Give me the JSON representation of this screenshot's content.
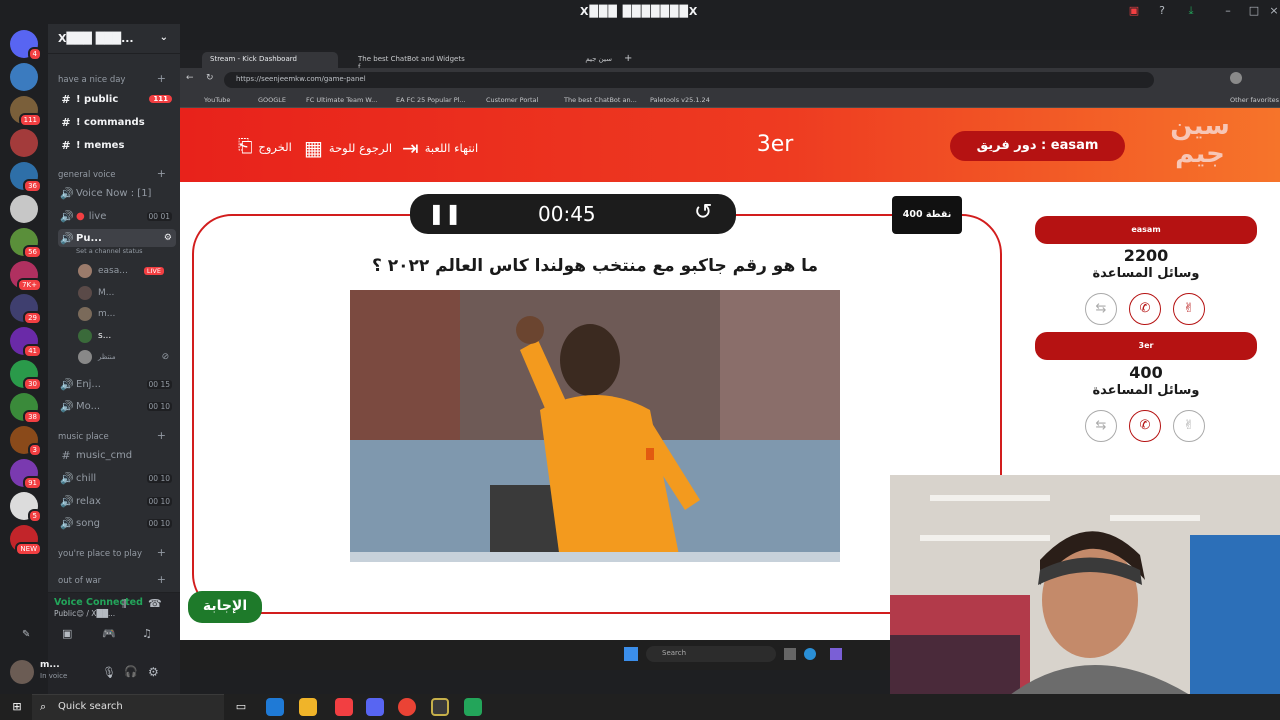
{
  "window": {
    "title": "X███ ███████X"
  },
  "discord": {
    "server_name": "X███ ███...",
    "categories": {
      "top": "have a nice day",
      "general_voice": "general voice",
      "music_place": "music place",
      "play": "you're place to play",
      "war": "out of war"
    },
    "text_channels": [
      {
        "label": "! public",
        "badge": "111"
      },
      {
        "label": "! commands"
      },
      {
        "label": "! memes"
      }
    ],
    "voice_now": "Voice Now : [1]",
    "voice_channels": [
      {
        "label": "live",
        "count": "00 01"
      },
      {
        "label": "Pu...",
        "status": "Set a channel status"
      },
      {
        "label": "Enj...",
        "count": "00 15"
      },
      {
        "label": "Mo...",
        "count": "00 10"
      }
    ],
    "voice_users": [
      {
        "name": "easa...",
        "live": "LIVE"
      },
      {
        "name": "M..."
      },
      {
        "name": "m..."
      },
      {
        "name": "s..."
      },
      {
        "name": "منتظر"
      }
    ],
    "music_channels": [
      {
        "label": "music_cmd"
      },
      {
        "label": "chill",
        "count": "00 10"
      },
      {
        "label": "relax",
        "count": "00 10"
      },
      {
        "label": "song",
        "count": "00 10"
      }
    ],
    "voice_connected": "Voice Connected",
    "voice_connected_sub": "Public😊 / X██...",
    "user": {
      "name": "m...",
      "status": "In voice"
    }
  },
  "servers": [
    {
      "color": "#5865f2",
      "badge": "4"
    },
    {
      "color": "#3b7bbf",
      "badge": ""
    },
    {
      "color": "#7a5f3a",
      "badge": "111"
    },
    {
      "color": "#a33b3b",
      "badge": ""
    },
    {
      "color": "#2e6fa8",
      "badge": "36"
    },
    {
      "color": "#c7c7c7",
      "badge": ""
    },
    {
      "color": "#5a8f3a",
      "badge": "56"
    },
    {
      "color": "#b03060",
      "badge": "7K+"
    },
    {
      "color": "#3f3f6f",
      "badge": "29"
    },
    {
      "color": "#6a2aa8",
      "badge": "41"
    },
    {
      "color": "#2a9a4a",
      "badge": "30"
    },
    {
      "color": "#3a8a3a",
      "badge": "38"
    },
    {
      "color": "#8a4a1a",
      "badge": "3"
    },
    {
      "color": "#7a3ab0",
      "badge": "91"
    },
    {
      "color": "#dcdcdc",
      "badge": "5"
    },
    {
      "color": "#c2252a",
      "badge": "NEW"
    }
  ],
  "browser": {
    "tabs": [
      "Stream - Kick Dashboard",
      "The best ChatBot and Widgets f...",
      "سين جيم"
    ],
    "url": "https://seenjeemkw.com/game-panel",
    "bookmarks": [
      "YouTube",
      "GOOGLE",
      "FC Ultimate Team W...",
      "EA FC 25 Popular Pl...",
      "Customer Portal",
      "The best ChatBot an...",
      "Paletools v25.1.24"
    ],
    "other_bookmarks": "Other favorites"
  },
  "game": {
    "logo": "سين جيم",
    "team_turn": "دور فريق : easam",
    "current_team": "3er",
    "end_game": "انتهاء اللعبة",
    "back_to_board": "الرجوع للوحة",
    "exit": "الخروج",
    "timer": "00:45",
    "points": "400 نقطة",
    "question": "ما هو رقم جاكبو مع منتخب هولندا كاس العالم ٢٠٢٢ ؟",
    "answer_button": "الإجابة",
    "teams": [
      {
        "name": "easam",
        "score": "2200",
        "aids_label": "وسائل المساعدة"
      },
      {
        "name": "3er",
        "score": "400",
        "aids_label": "وسائل المساعدة"
      }
    ]
  },
  "inner_taskbar": {
    "search": "Search"
  },
  "taskbar": {
    "search": "Quick search"
  },
  "colors": {
    "accent_red": "#b51212",
    "answer_green": "#1e7a2a",
    "discord_bg": "#2b2d31"
  }
}
